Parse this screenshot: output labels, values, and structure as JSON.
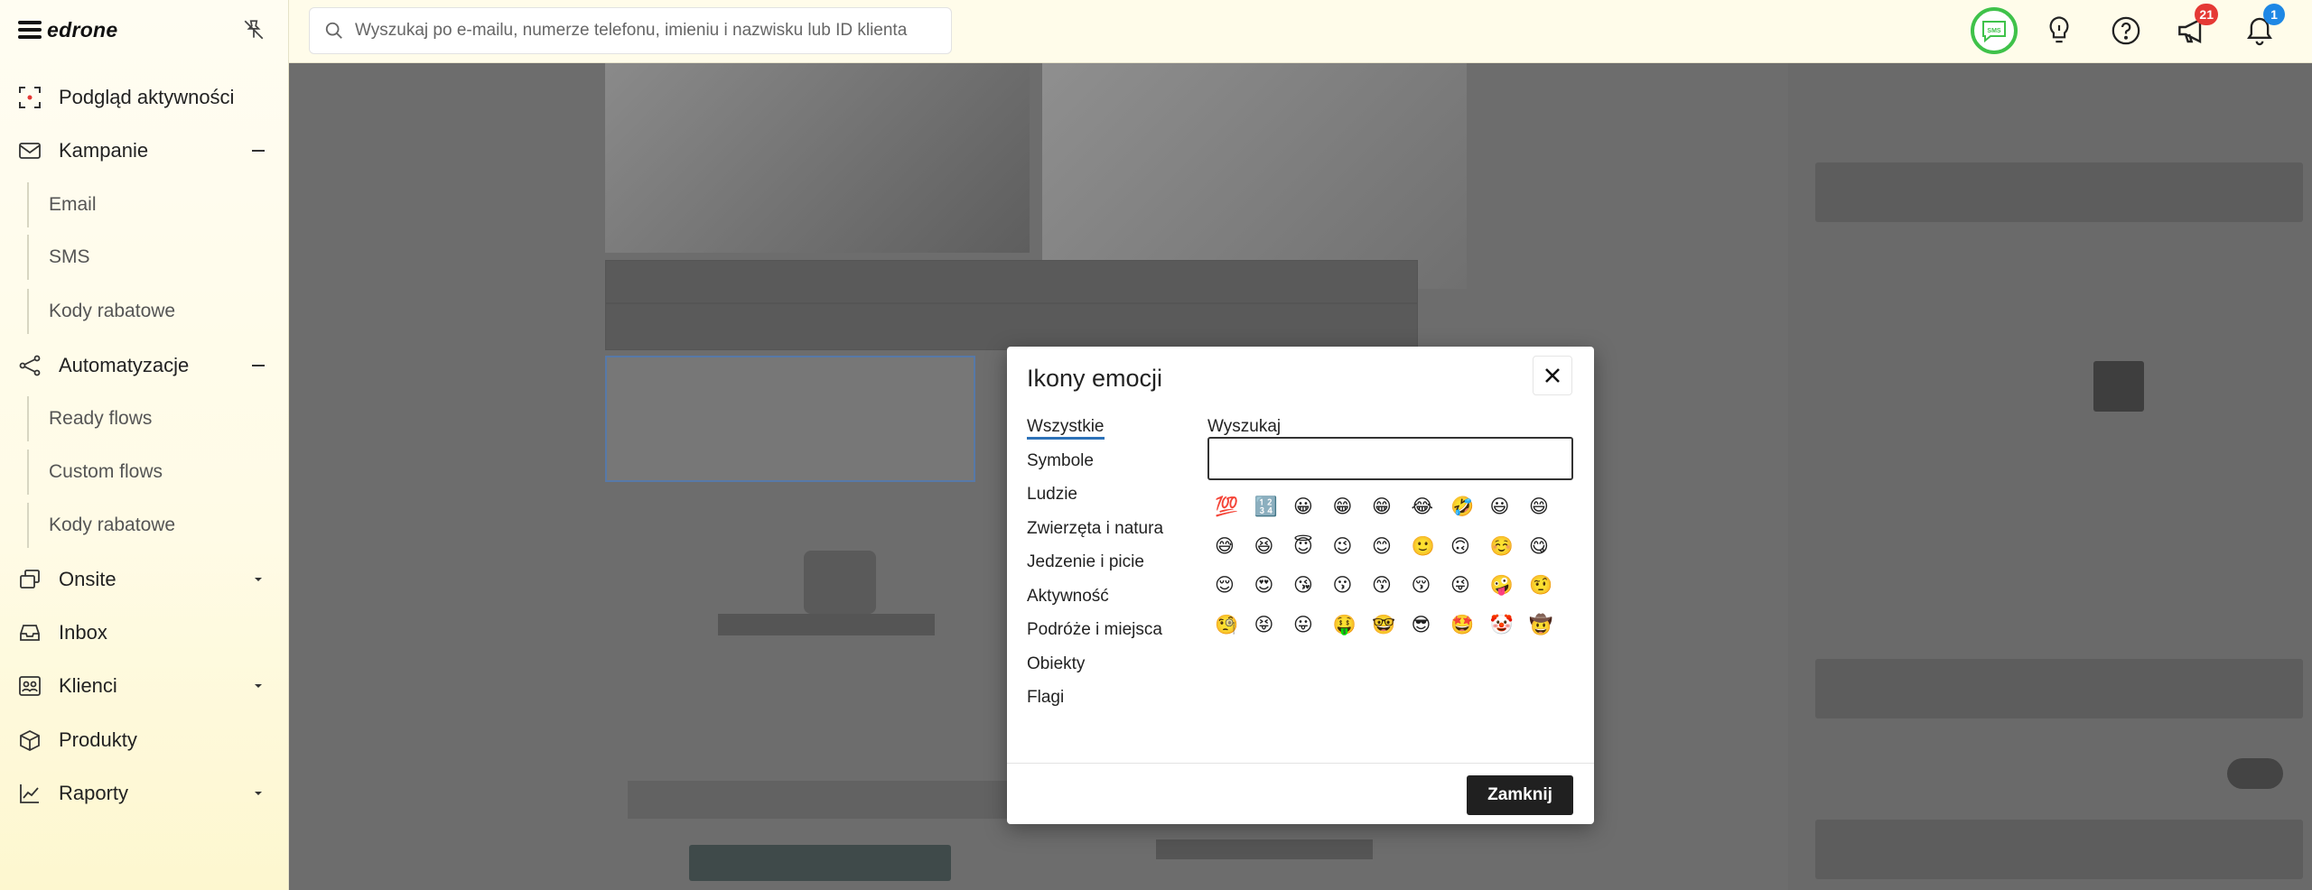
{
  "app": {
    "logo": "edrone"
  },
  "search": {
    "placeholder": "Wyszukaj po e-mailu, numerze telefonu, imieniu i nazwisku lub ID klienta"
  },
  "topbar": {
    "sms_label": "SMS",
    "announcements_badge": "21",
    "notifications_badge": "1",
    "accent": "#3fc24a",
    "badge_color": "#e53935",
    "badge_blue": "#1e88e5"
  },
  "sidebar": {
    "items": [
      {
        "label": "Podgląd aktywności",
        "icon": "activity-icon"
      },
      {
        "label": "Kampanie",
        "icon": "mail-icon",
        "trail": "collapse"
      },
      {
        "label": "Automatyzacje",
        "icon": "share-icon",
        "trail": "collapse"
      },
      {
        "label": "Onsite",
        "icon": "onsite-icon",
        "trail": "expand"
      },
      {
        "label": "Inbox",
        "icon": "inbox-icon"
      },
      {
        "label": "Klienci",
        "icon": "users-icon",
        "trail": "expand"
      },
      {
        "label": "Produkty",
        "icon": "box-icon"
      },
      {
        "label": "Raporty",
        "icon": "chart-icon",
        "trail": "expand"
      }
    ],
    "kampanie_sub": [
      "Email",
      "SMS",
      "Kody rabatowe"
    ],
    "automatyzacje_sub": [
      "Ready flows",
      "Custom flows",
      "Kody rabatowe"
    ]
  },
  "modal": {
    "title": "Ikony emocji",
    "categories": [
      "Wszystkie",
      "Symbole",
      "Ludzie",
      "Zwierzęta i natura",
      "Jedzenie i picie",
      "Aktywność",
      "Podróże i miejsca",
      "Obiekty",
      "Flagi"
    ],
    "active_category": "Wszystkie",
    "search_label": "Wyszukaj",
    "search_value": "",
    "emojis": [
      "💯",
      "🔢",
      "😀",
      "😁",
      "😁",
      "😂",
      "🤣",
      "😃",
      "😄",
      "😅",
      "😆",
      "😇",
      "😉",
      "😊",
      "🙂",
      "🙃",
      "☺️",
      "😋",
      "😌",
      "😍",
      "😘",
      "😗",
      "😙",
      "😚",
      "😜",
      "🤪",
      "🤨",
      "🧐",
      "😝",
      "😛",
      "🤑",
      "🤓",
      "😎",
      "🤩",
      "🤡",
      "🤠",
      "🤗",
      "😏",
      "😶",
      "😐",
      "😑",
      "😒",
      "🙄",
      "🤔",
      "🤥",
      "🤭",
      "🤫",
      "🤬",
      "🤯",
      "😳",
      "😞",
      "😟",
      "😠",
      "😡",
      "😔",
      "😕",
      "🙁",
      "☹️",
      "😣",
      "😖",
      "😫",
      "😩",
      "😤"
    ],
    "close_button": "Zamknij"
  }
}
